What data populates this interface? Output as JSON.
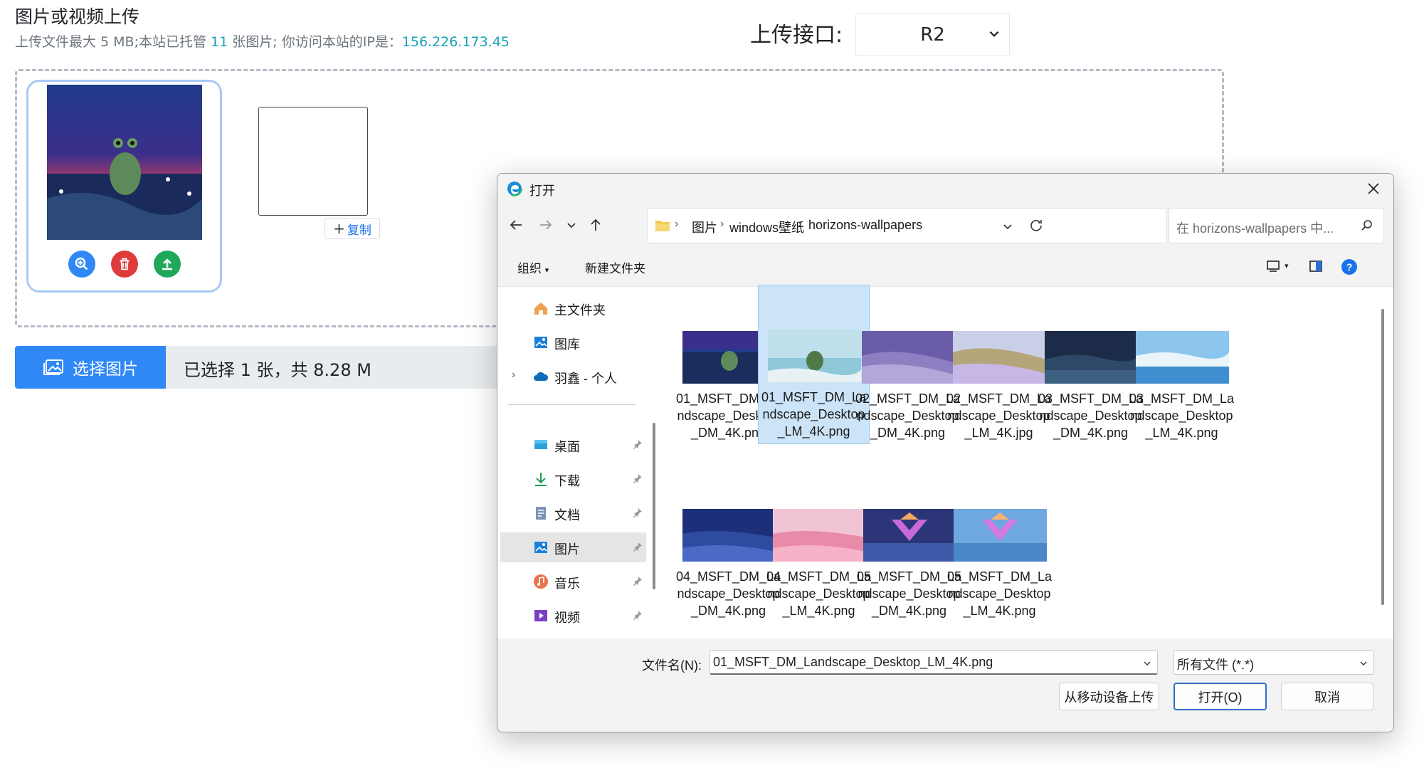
{
  "page": {
    "title": "图片或视频上传",
    "subtitle_prefix": "上传文件最大 5 MB;本站已托管 ",
    "hosted_count": "11",
    "subtitle_mid": " 张图片; 你访问本站的IP是：",
    "ip": "156.226.173.45",
    "interface_label": "上传接口:",
    "interface_value": "R2",
    "copy_label": "复制",
    "select_button": "选择图片",
    "selected_info": "已选择 1 张，共 8.28 M",
    "colors": {
      "accent": "#2f88f5",
      "link": "#17a2b8",
      "zoom": "#2f88f5",
      "delete": "#e03b3b",
      "upload": "#1fa85a"
    }
  },
  "dialog": {
    "title": "打开",
    "breadcrumb": [
      "图片",
      "windows壁纸",
      "horizons-wallpapers"
    ],
    "search_placeholder": "在 horizons-wallpapers 中...",
    "toolbar": {
      "organize": "组织",
      "new_folder": "新建文件夹"
    },
    "nav_items": [
      {
        "label": "主文件夹",
        "icon": "home-icon"
      },
      {
        "label": "图库",
        "icon": "gallery-icon"
      },
      {
        "label": "羽鑫 - 个人",
        "icon": "onedrive-cloud-icon"
      },
      {
        "label": "桌面",
        "icon": "desktop-icon"
      },
      {
        "label": "下载",
        "icon": "download-icon"
      },
      {
        "label": "文档",
        "icon": "documents-icon"
      },
      {
        "label": "图片",
        "icon": "pictures-icon"
      },
      {
        "label": "音乐",
        "icon": "music-icon"
      },
      {
        "label": "视频",
        "icon": "video-icon"
      }
    ],
    "files": [
      {
        "name": "01_MSFT_DM_Landscape_Desktop_DM_4K.png"
      },
      {
        "name": "01_MSFT_DM_Landscape_Desktop_LM_4K.png"
      },
      {
        "name": "02_MSFT_DM_Landscape_Desktop_DM_4K.png"
      },
      {
        "name": "02_MSFT_DM_Landscape_Desktop_LM_4K.jpg"
      },
      {
        "name": "03_MSFT_DM_Landscape_Desktop_DM_4K.png"
      },
      {
        "name": "03_MSFT_DM_Landscape_Desktop_LM_4K.png"
      },
      {
        "name": "04_MSFT_DM_Landscape_Desktop_DM_4K.png"
      },
      {
        "name": "04_MSFT_DM_Landscape_Desktop_LM_4K.png"
      },
      {
        "name": "05_MSFT_DM_Landscape_Desktop_DM_4K.png"
      },
      {
        "name": "05_MSFT_DM_Landscape_Desktop_LM_4K.png"
      }
    ],
    "filename_label": "文件名(N):",
    "filename_value": "01_MSFT_DM_Landscape_Desktop_LM_4K.png",
    "filetype_value": "所有文件 (*.*)",
    "buttons": {
      "mobile_upload": "从移动设备上传",
      "open": "打开(O)",
      "cancel": "取消"
    }
  }
}
